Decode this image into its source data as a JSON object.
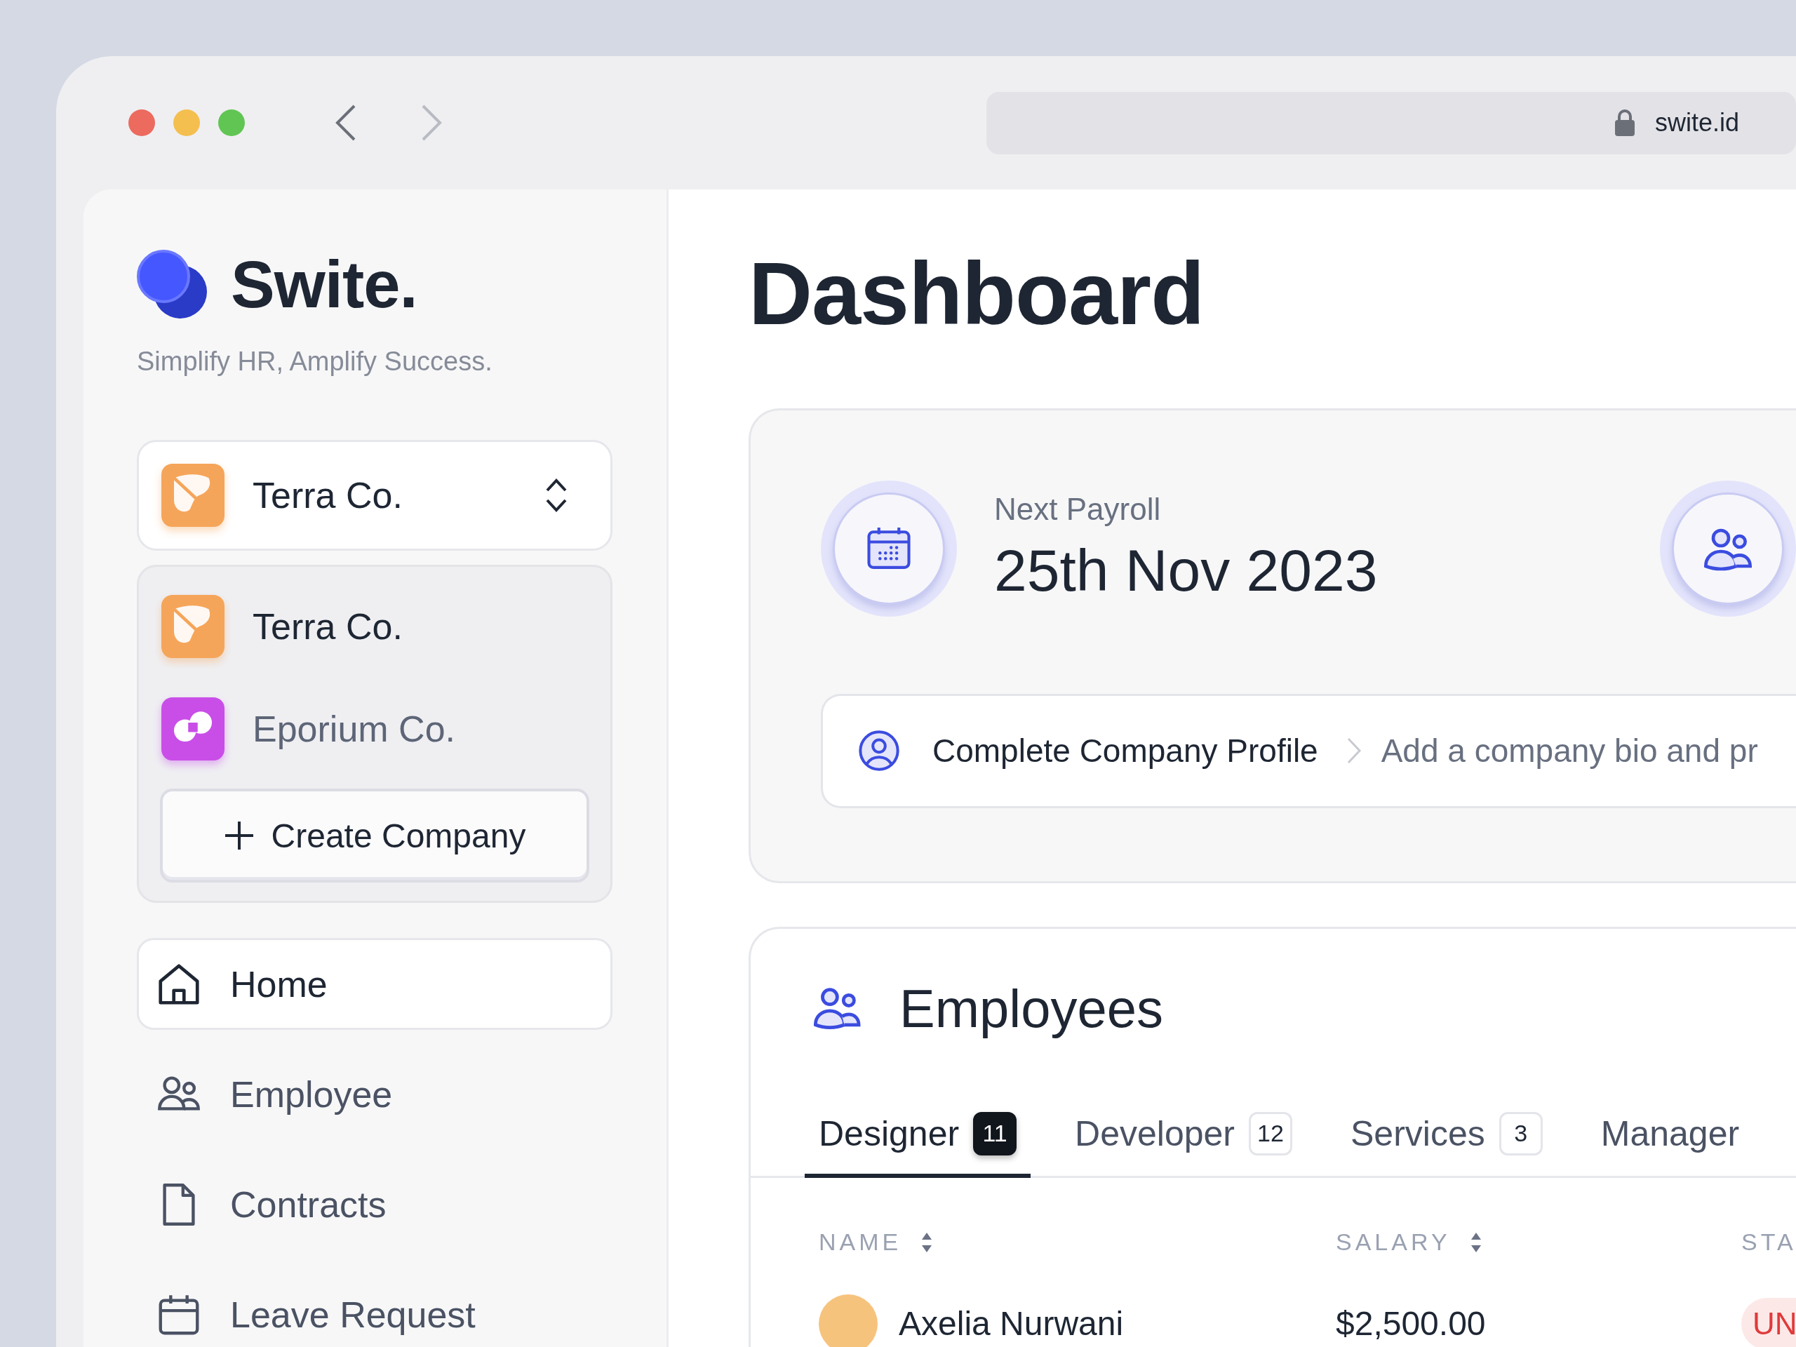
{
  "browser": {
    "url": "swite.id"
  },
  "brand": {
    "name": "Swite.",
    "tagline": "Simplify HR, Amplify Success."
  },
  "company_switcher": {
    "current": {
      "name": "Terra Co.",
      "kind": "terra",
      "color": "#f5a55a"
    },
    "expanded": true,
    "companies": [
      {
        "name": "Terra Co.",
        "kind": "terra",
        "color": "#f5a55a",
        "selected": true
      },
      {
        "name": "Eporium Co.",
        "kind": "eporium",
        "color": "#c94ee8",
        "selected": false
      }
    ],
    "create_button": "Create Company"
  },
  "nav": [
    {
      "label": "Home",
      "kind": "home",
      "selected": true
    },
    {
      "label": "Employee",
      "kind": "people",
      "selected": false
    },
    {
      "label": "Contracts",
      "kind": "document",
      "selected": false
    },
    {
      "label": "Leave Request",
      "kind": "calendar",
      "selected": false
    }
  ],
  "page_title": "Dashboard",
  "payroll": {
    "label": "Next Payroll",
    "date": "25th Nov 2023"
  },
  "profile_task": {
    "title": "Complete Company Profile",
    "description": "Add a company bio and pr"
  },
  "employees": {
    "title": "Employees",
    "tabs": [
      {
        "label": "Designer",
        "count": "11",
        "selected": true
      },
      {
        "label": "Developer",
        "count": "12",
        "selected": false
      },
      {
        "label": "Services",
        "count": "3",
        "selected": false
      },
      {
        "label": "Manager",
        "selected": false
      }
    ],
    "columns": [
      {
        "label": "NAME",
        "sortable": true
      },
      {
        "label": "SALARY",
        "sortable": true
      },
      {
        "label": "STA",
        "sortable": false
      }
    ],
    "rows": [
      {
        "name": "Axelia Nurwani",
        "salary": "$2,500.00",
        "status": "UN"
      }
    ]
  }
}
